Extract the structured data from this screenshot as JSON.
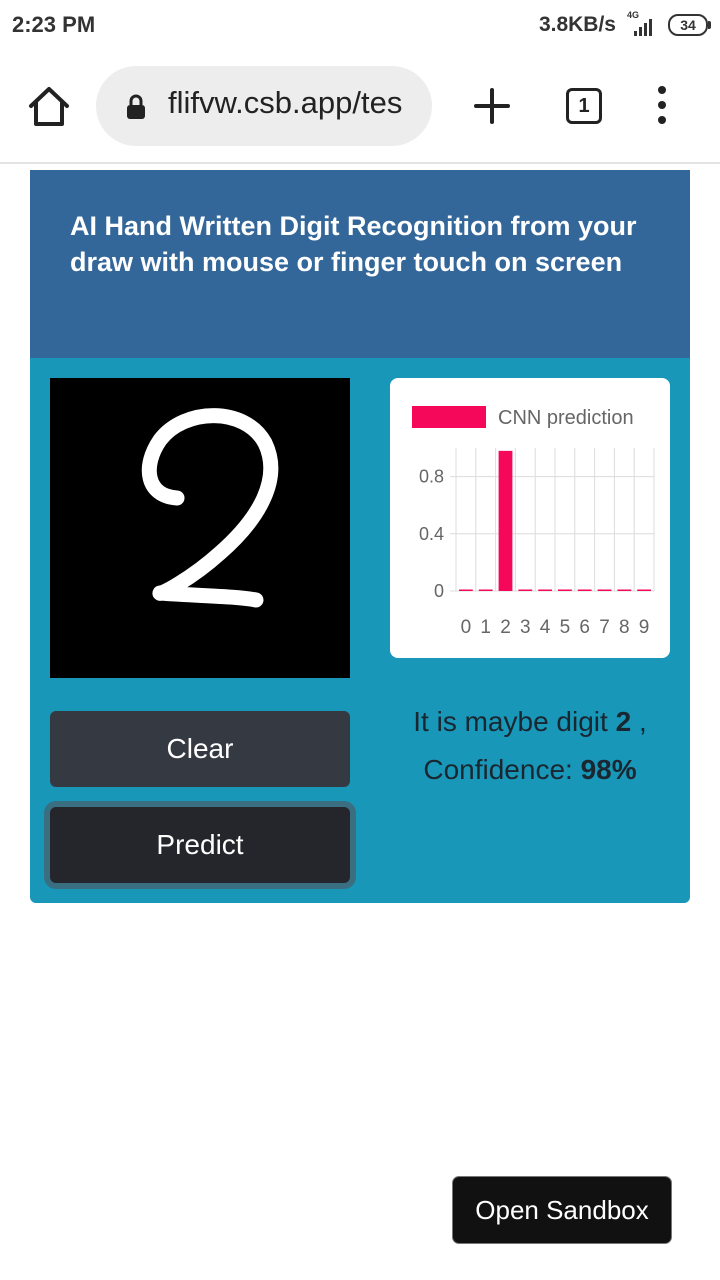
{
  "status_bar": {
    "time": "2:23 PM",
    "net_speed": "3.8KB/s",
    "network_type": "4G",
    "battery": "34"
  },
  "browser": {
    "url": "flifvw.csb.app/tes",
    "tab_count": "1"
  },
  "app": {
    "title": "AI Hand Written Digit Recognition from your draw with mouse or finger touch on screen",
    "clear_label": "Clear",
    "predict_label": "Predict",
    "result_prefix": "It is maybe digit",
    "result_digit": "2",
    "result_sep": ",",
    "confidence_label": "Confidence:",
    "confidence_value": "98%",
    "drawn_digit": "2"
  },
  "sandbox_button": "Open Sandbox",
  "chart_data": {
    "type": "bar",
    "legend": [
      "CNN prediction"
    ],
    "categories": [
      "0",
      "1",
      "2",
      "3",
      "4",
      "5",
      "6",
      "7",
      "8",
      "9"
    ],
    "series": [
      {
        "name": "CNN prediction",
        "values": [
          0.0,
          0.0,
          0.98,
          0.0,
          0.0,
          0.0,
          0.0,
          0.0,
          0.0,
          0.0
        ]
      }
    ],
    "y_ticks": [
      "0.8",
      "0.4",
      "0"
    ],
    "ylim": [
      0,
      1
    ],
    "color": "#f5085a",
    "grid": true,
    "legend_position": "top"
  }
}
